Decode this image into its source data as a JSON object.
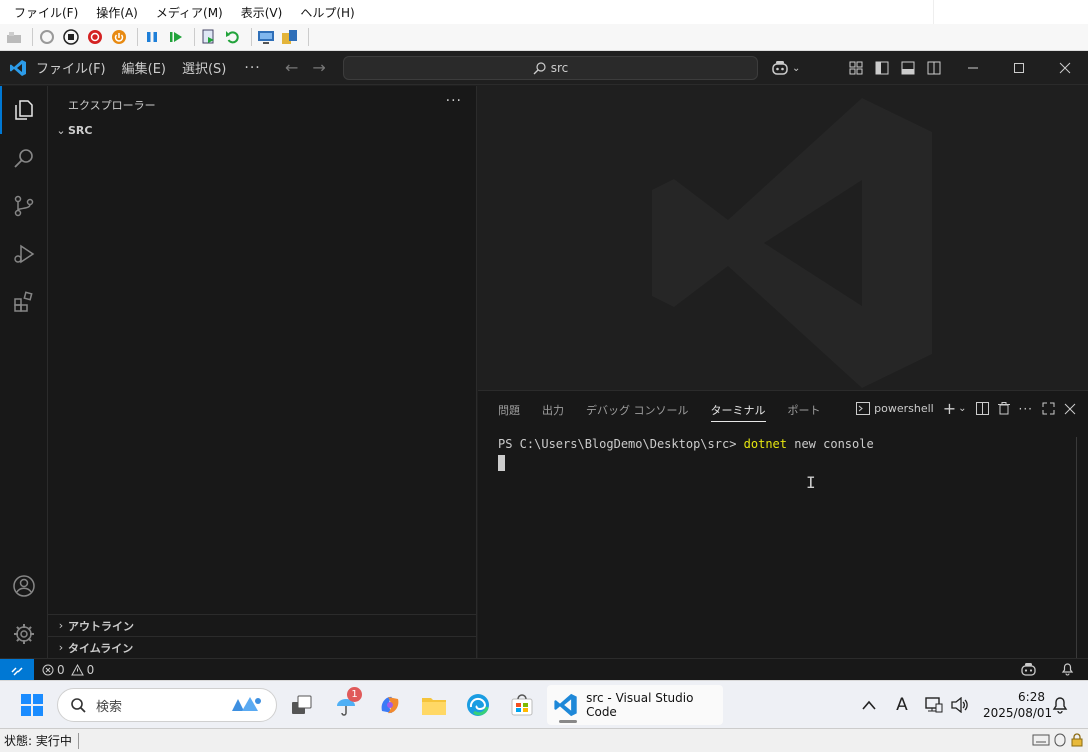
{
  "vm": {
    "menu": [
      "ファイル(F)",
      "操作(A)",
      "メディア(M)",
      "表示(V)",
      "ヘルプ(H)"
    ],
    "status": "状態: 実行中"
  },
  "vscode": {
    "menu": [
      "ファイル(F)",
      "編集(E)",
      "選択(S)"
    ],
    "more": "···",
    "search": "src",
    "sidebar": {
      "title": "エクスプローラー",
      "more": "···",
      "folder": "SRC",
      "sections": [
        "アウトライン",
        "タイムライン"
      ]
    },
    "panel": {
      "tabs": [
        "問題",
        "出力",
        "デバッグ コンソール",
        "ターミナル",
        "ポート"
      ],
      "active_tab": "ターミナル",
      "shell": "powershell",
      "prompt": "PS C:\\Users\\BlogDemo\\Desktop\\src> ",
      "command": "dotnet",
      "args": " new console"
    },
    "status": {
      "errors": "0",
      "warnings": "0"
    }
  },
  "taskbar": {
    "search_placeholder": "検索",
    "badge": "1",
    "app_label": "src - Visual Studio Code",
    "time": "6:28",
    "date": "2025/08/01",
    "ime": "A"
  },
  "colors": {
    "accent": "#0078d4",
    "terminal_command": "#e5e510",
    "editor_bg": "#1f1f1f",
    "sidebar_bg": "#181818"
  }
}
